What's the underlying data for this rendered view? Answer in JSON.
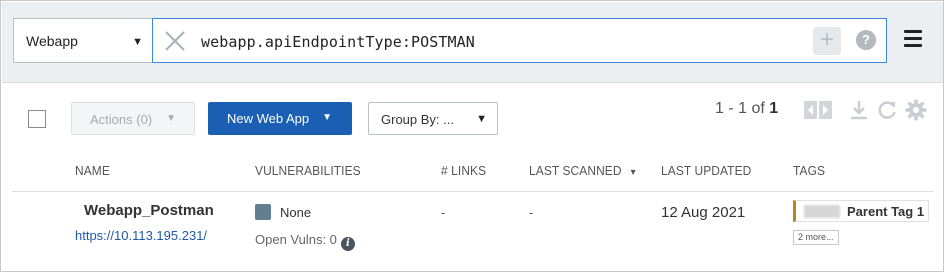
{
  "search": {
    "type_value": "Webapp",
    "query": "webapp.apiEndpointType:POSTMAN",
    "add_label": "+",
    "help_label": "?"
  },
  "toolbar": {
    "actions_label": "Actions (0)",
    "new_label": "New Web App",
    "group_label": "Group By: ...",
    "pager_range": "1 - 1 of",
    "pager_total": "1"
  },
  "table": {
    "headers": [
      "NAME",
      "VULNERABILITIES",
      "# LINKS",
      "LAST SCANNED",
      "LAST UPDATED",
      "TAGS"
    ],
    "rows": [
      {
        "name": "Webapp_Postman",
        "url": "https://10.113.195.231/",
        "severity": "None",
        "open_vulns": "Open Vulns: 0",
        "links": "-",
        "last_scanned": "-",
        "last_updated": "12 Aug 2021",
        "tag": "Parent Tag 1",
        "more_tags": "2 more..."
      }
    ]
  },
  "colors": {
    "primary": "#1a5fb4",
    "focus_border": "#3b8ad9",
    "severity_none": "#637d92",
    "tag_accent": "#b5891f"
  },
  "icons": [
    "clear-icon",
    "plus-icon",
    "help-icon",
    "hamburger-menu-icon",
    "collapse-icon",
    "download-icon",
    "refresh-icon",
    "gear-icon",
    "info-icon"
  ]
}
